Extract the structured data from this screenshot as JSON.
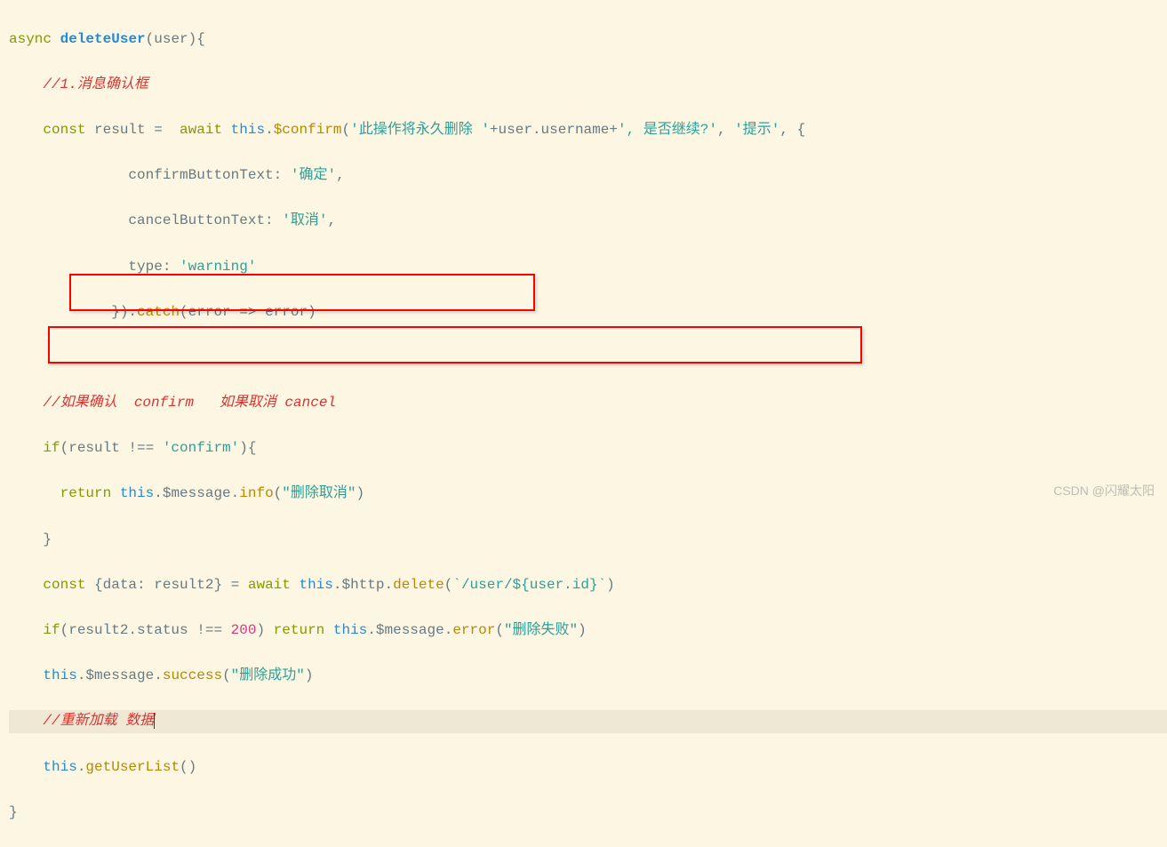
{
  "code": {
    "l1_async": "async",
    "l1_fn": "deleteUser",
    "l1_paren_open": "(",
    "l1_param": "user",
    "l1_paren_close": "){",
    "l2_indent": "    ",
    "l2_comment": "//1.消息确认框",
    "l3_indent": "    ",
    "l3_const": "const",
    "l3_result": " result =  ",
    "l3_await": "await",
    "l3_this": " this",
    "l3_dot1": ".",
    "l3_confirm": "$confirm",
    "l3_open": "(",
    "l3_str": "'此操作将永久删除 '",
    "l3_plus1": "+",
    "l3_user": "user",
    "l3_dot2": ".",
    "l3_username": "username",
    "l3_plus2": "+",
    "l3_str2": "', 是否继续?'",
    "l3_comma": ", ",
    "l3_str3": "'提示'",
    "l3_end": ", {",
    "l4_indent": "              ",
    "l4_key": "confirmButtonText",
    "l4_colon": ": ",
    "l4_val": "'确定'",
    "l4_comma": ",",
    "l5_indent": "              ",
    "l5_key": "cancelButtonText",
    "l5_colon": ": ",
    "l5_val": "'取消'",
    "l5_comma": ",",
    "l6_indent": "              ",
    "l6_key": "type",
    "l6_colon": ": ",
    "l6_val": "'warning'",
    "l7_indent": "            }).",
    "l7_catch": "catch",
    "l7_rest": "(error => error)",
    "l9_indent": "    ",
    "l9_comment": "//如果确认  confirm   如果取消 cancel",
    "l10_indent": "    ",
    "l10_if": "if",
    "l10_open": "(result !== ",
    "l10_str": "'confirm'",
    "l10_close": "){",
    "l11_indent": "      ",
    "l11_return": "return",
    "l11_this": " this",
    "l11_dot": ".",
    "l11_msg": "$message",
    "l11_dot2": ".",
    "l11_info": "info",
    "l11_open": "(",
    "l11_str": "\"删除取消\"",
    "l11_close": ")",
    "l12_indent": "    }",
    "l13_indent": "    ",
    "l13_const": "const",
    "l13_open": " {",
    "l13_data": "data",
    "l13_colon": ": ",
    "l13_result2": "result2",
    "l13_close": "} = ",
    "l13_await": "await",
    "l13_this": " this",
    "l13_dot": ".",
    "l13_http": "$http",
    "l13_dot2": ".",
    "l13_delete": "delete",
    "l13_popen": "(",
    "l13_tmpl": "`/user/${user.id}`",
    "l13_pclose": ")",
    "l14_indent": "    ",
    "l14_if": "if",
    "l14_open": "(result2.status !== ",
    "l14_num": "200",
    "l14_close": ") ",
    "l14_return": "return",
    "l14_this": " this",
    "l14_dot": ".",
    "l14_msg": "$message",
    "l14_dot2": ".",
    "l14_error": "error",
    "l14_popen": "(",
    "l14_str": "\"删除失败\"",
    "l14_pclose": ")",
    "l15_indent": "    ",
    "l15_this": "this",
    "l15_dot": ".",
    "l15_msg": "$message",
    "l15_dot2": ".",
    "l15_success": "success",
    "l15_open": "(",
    "l15_str": "\"删除成功\"",
    "l15_close": ")",
    "l16_indent": "    ",
    "l16_comment": "//重新加载 数据",
    "l17_indent": "    ",
    "l17_this": "this",
    "l17_dot": ".",
    "l17_fn": "getUserList",
    "l17_parens": "()",
    "l18": "}"
  },
  "watermark": "CSDN @闪耀太阳"
}
